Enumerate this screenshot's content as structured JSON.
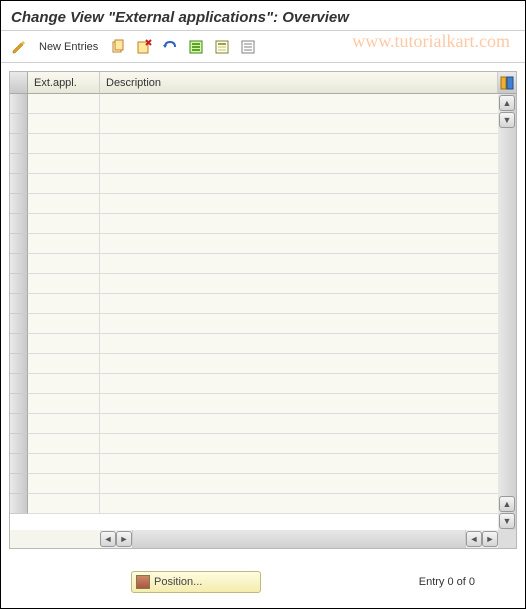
{
  "title": "Change View \"External applications\": Overview",
  "toolbar": {
    "change_tooltip": "Change",
    "new_entries_label": "New Entries",
    "copy_tooltip": "Copy As...",
    "delete_tooltip": "Delete",
    "undo_tooltip": "Undo Change",
    "select_all_tooltip": "Select All",
    "select_block_tooltip": "Select Block",
    "deselect_tooltip": "Deselect All"
  },
  "table": {
    "columns": {
      "ext_appl": "Ext.appl.",
      "description": "Description"
    },
    "rows": [
      {
        "ext_appl": "",
        "description": ""
      },
      {
        "ext_appl": "",
        "description": ""
      },
      {
        "ext_appl": "",
        "description": ""
      },
      {
        "ext_appl": "",
        "description": ""
      },
      {
        "ext_appl": "",
        "description": ""
      },
      {
        "ext_appl": "",
        "description": ""
      },
      {
        "ext_appl": "",
        "description": ""
      },
      {
        "ext_appl": "",
        "description": ""
      },
      {
        "ext_appl": "",
        "description": ""
      },
      {
        "ext_appl": "",
        "description": ""
      },
      {
        "ext_appl": "",
        "description": ""
      },
      {
        "ext_appl": "",
        "description": ""
      },
      {
        "ext_appl": "",
        "description": ""
      },
      {
        "ext_appl": "",
        "description": ""
      },
      {
        "ext_appl": "",
        "description": ""
      },
      {
        "ext_appl": "",
        "description": ""
      },
      {
        "ext_appl": "",
        "description": ""
      },
      {
        "ext_appl": "",
        "description": ""
      },
      {
        "ext_appl": "",
        "description": ""
      },
      {
        "ext_appl": "",
        "description": ""
      },
      {
        "ext_appl": "",
        "description": ""
      }
    ]
  },
  "footer": {
    "position_button": "Position...",
    "entry_text": "Entry 0 of 0"
  },
  "watermark": "www.tutorialkart.com"
}
